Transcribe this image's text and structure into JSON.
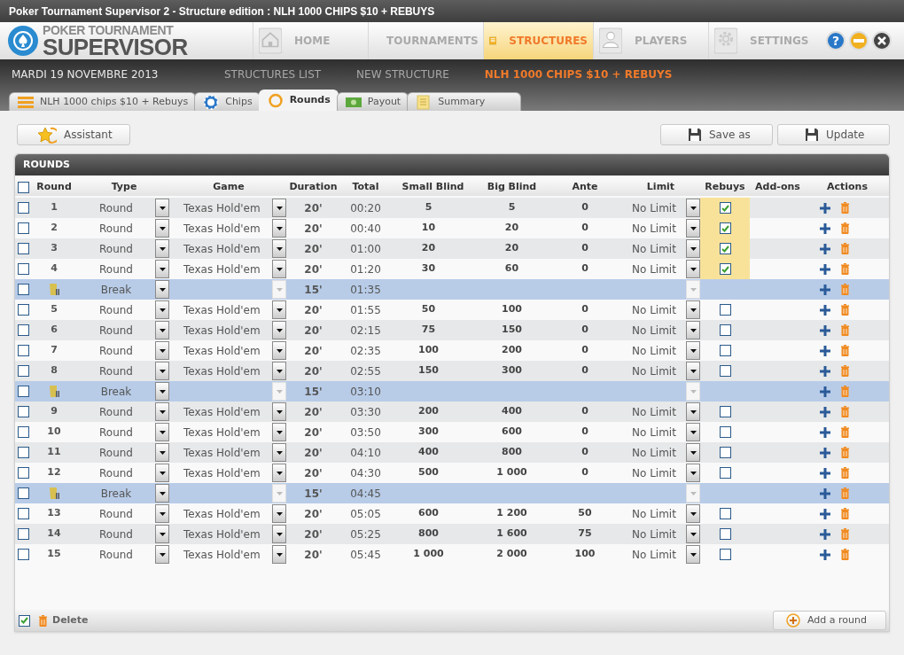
{
  "window": {
    "title": "Poker Tournament Supervisor 2 - Structure edition : NLH 1000 CHIPS $10 + REBUYS"
  },
  "logo": {
    "line1": "POKER TOURNAMENT",
    "line2": "SUPERVISOR"
  },
  "nav": [
    {
      "kind": "home",
      "label": "HOME",
      "selected": false
    },
    {
      "kind": "tournaments",
      "label": "TOURNAMENTS",
      "selected": false
    },
    {
      "kind": "structures",
      "label": "STRUCTURES",
      "selected": true
    },
    {
      "kind": "players",
      "label": "PLAYERS",
      "selected": false
    },
    {
      "kind": "settings",
      "label": "SETTINGS",
      "selected": false
    }
  ],
  "window_buttons": [
    {
      "kind": "help",
      "label": "?"
    },
    {
      "kind": "minimize"
    },
    {
      "kind": "close"
    }
  ],
  "date": "MARDI 19 NOVEMBRE 2013",
  "sub_nav": [
    {
      "label": "STRUCTURES LIST",
      "selected": false
    },
    {
      "label": "NEW STRUCTURE",
      "selected": false
    },
    {
      "label": "NLH 1000 CHIPS $10 + REBUYS",
      "selected": true
    }
  ],
  "tabs": [
    {
      "kind": "structure",
      "label": "NLH 1000 chips $10 + Rebuys",
      "selected": false
    },
    {
      "kind": "chips",
      "label": "Chips",
      "selected": false
    },
    {
      "kind": "rounds",
      "label": "Rounds",
      "selected": true
    },
    {
      "kind": "payout",
      "label": "Payout",
      "selected": false
    },
    {
      "kind": "summary",
      "label": "Summary",
      "selected": false
    }
  ],
  "toolbar": {
    "assistant": "Assistant",
    "save_as": "Save as",
    "update": "Update"
  },
  "panel_title": "ROUNDS",
  "table": {
    "select_all": false,
    "columns": [
      "Round",
      "Type",
      "Game",
      "Duration",
      "Total",
      "Small Blind",
      "Big Blind",
      "Ante",
      "Limit",
      "Rebuys",
      "Add-ons",
      "Actions"
    ],
    "rows": [
      {
        "kind": "round",
        "selected": false,
        "round": "1",
        "type": "Round",
        "game": "Texas Hold'em",
        "duration": "20'",
        "total": "00:20",
        "small_blind": "5",
        "big_blind": "5",
        "ante": "0",
        "limit": "No Limit",
        "rebuys": true
      },
      {
        "kind": "round",
        "selected": false,
        "round": "2",
        "type": "Round",
        "game": "Texas Hold'em",
        "duration": "20'",
        "total": "00:40",
        "small_blind": "10",
        "big_blind": "20",
        "ante": "0",
        "limit": "No Limit",
        "rebuys": true
      },
      {
        "kind": "round",
        "selected": false,
        "round": "3",
        "type": "Round",
        "game": "Texas Hold'em",
        "duration": "20'",
        "total": "01:00",
        "small_blind": "20",
        "big_blind": "20",
        "ante": "0",
        "limit": "No Limit",
        "rebuys": true
      },
      {
        "kind": "round",
        "selected": false,
        "round": "4",
        "type": "Round",
        "game": "Texas Hold'em",
        "duration": "20'",
        "total": "01:20",
        "small_blind": "30",
        "big_blind": "60",
        "ante": "0",
        "limit": "No Limit",
        "rebuys": true
      },
      {
        "kind": "break",
        "selected": false,
        "type": "Break",
        "duration": "15'",
        "total": "01:35"
      },
      {
        "kind": "round",
        "selected": false,
        "round": "5",
        "type": "Round",
        "game": "Texas Hold'em",
        "duration": "20'",
        "total": "01:55",
        "small_blind": "50",
        "big_blind": "100",
        "ante": "0",
        "limit": "No Limit",
        "rebuys": false
      },
      {
        "kind": "round",
        "selected": false,
        "round": "6",
        "type": "Round",
        "game": "Texas Hold'em",
        "duration": "20'",
        "total": "02:15",
        "small_blind": "75",
        "big_blind": "150",
        "ante": "0",
        "limit": "No Limit",
        "rebuys": false
      },
      {
        "kind": "round",
        "selected": false,
        "round": "7",
        "type": "Round",
        "game": "Texas Hold'em",
        "duration": "20'",
        "total": "02:35",
        "small_blind": "100",
        "big_blind": "200",
        "ante": "0",
        "limit": "No Limit",
        "rebuys": false
      },
      {
        "kind": "round",
        "selected": false,
        "round": "8",
        "type": "Round",
        "game": "Texas Hold'em",
        "duration": "20'",
        "total": "02:55",
        "small_blind": "150",
        "big_blind": "300",
        "ante": "0",
        "limit": "No Limit",
        "rebuys": false
      },
      {
        "kind": "break",
        "selected": false,
        "type": "Break",
        "duration": "15'",
        "total": "03:10"
      },
      {
        "kind": "round",
        "selected": false,
        "round": "9",
        "type": "Round",
        "game": "Texas Hold'em",
        "duration": "20'",
        "total": "03:30",
        "small_blind": "200",
        "big_blind": "400",
        "ante": "0",
        "limit": "No Limit",
        "rebuys": false
      },
      {
        "kind": "round",
        "selected": false,
        "round": "10",
        "type": "Round",
        "game": "Texas Hold'em",
        "duration": "20'",
        "total": "03:50",
        "small_blind": "300",
        "big_blind": "600",
        "ante": "0",
        "limit": "No Limit",
        "rebuys": false
      },
      {
        "kind": "round",
        "selected": false,
        "round": "11",
        "type": "Round",
        "game": "Texas Hold'em",
        "duration": "20'",
        "total": "04:10",
        "small_blind": "400",
        "big_blind": "800",
        "ante": "0",
        "limit": "No Limit",
        "rebuys": false
      },
      {
        "kind": "round",
        "selected": false,
        "round": "12",
        "type": "Round",
        "game": "Texas Hold'em",
        "duration": "20'",
        "total": "04:30",
        "small_blind": "500",
        "big_blind": "1 000",
        "ante": "0",
        "limit": "No Limit",
        "rebuys": false
      },
      {
        "kind": "break",
        "selected": false,
        "type": "Break",
        "duration": "15'",
        "total": "04:45"
      },
      {
        "kind": "round",
        "selected": false,
        "round": "13",
        "type": "Round",
        "game": "Texas Hold'em",
        "duration": "20'",
        "total": "05:05",
        "small_blind": "600",
        "big_blind": "1 200",
        "ante": "50",
        "limit": "No Limit",
        "rebuys": false
      },
      {
        "kind": "round",
        "selected": false,
        "round": "14",
        "type": "Round",
        "game": "Texas Hold'em",
        "duration": "20'",
        "total": "05:25",
        "small_blind": "800",
        "big_blind": "1 600",
        "ante": "75",
        "limit": "No Limit",
        "rebuys": false
      },
      {
        "kind": "round",
        "selected": false,
        "round": "15",
        "type": "Round",
        "game": "Texas Hold'em",
        "duration": "20'",
        "total": "05:45",
        "small_blind": "1 000",
        "big_blind": "2 000",
        "ante": "100",
        "limit": "No Limit",
        "rebuys": false
      }
    ]
  },
  "footer": {
    "select_checked": true,
    "delete": "Delete",
    "add_round": "Add a round"
  }
}
